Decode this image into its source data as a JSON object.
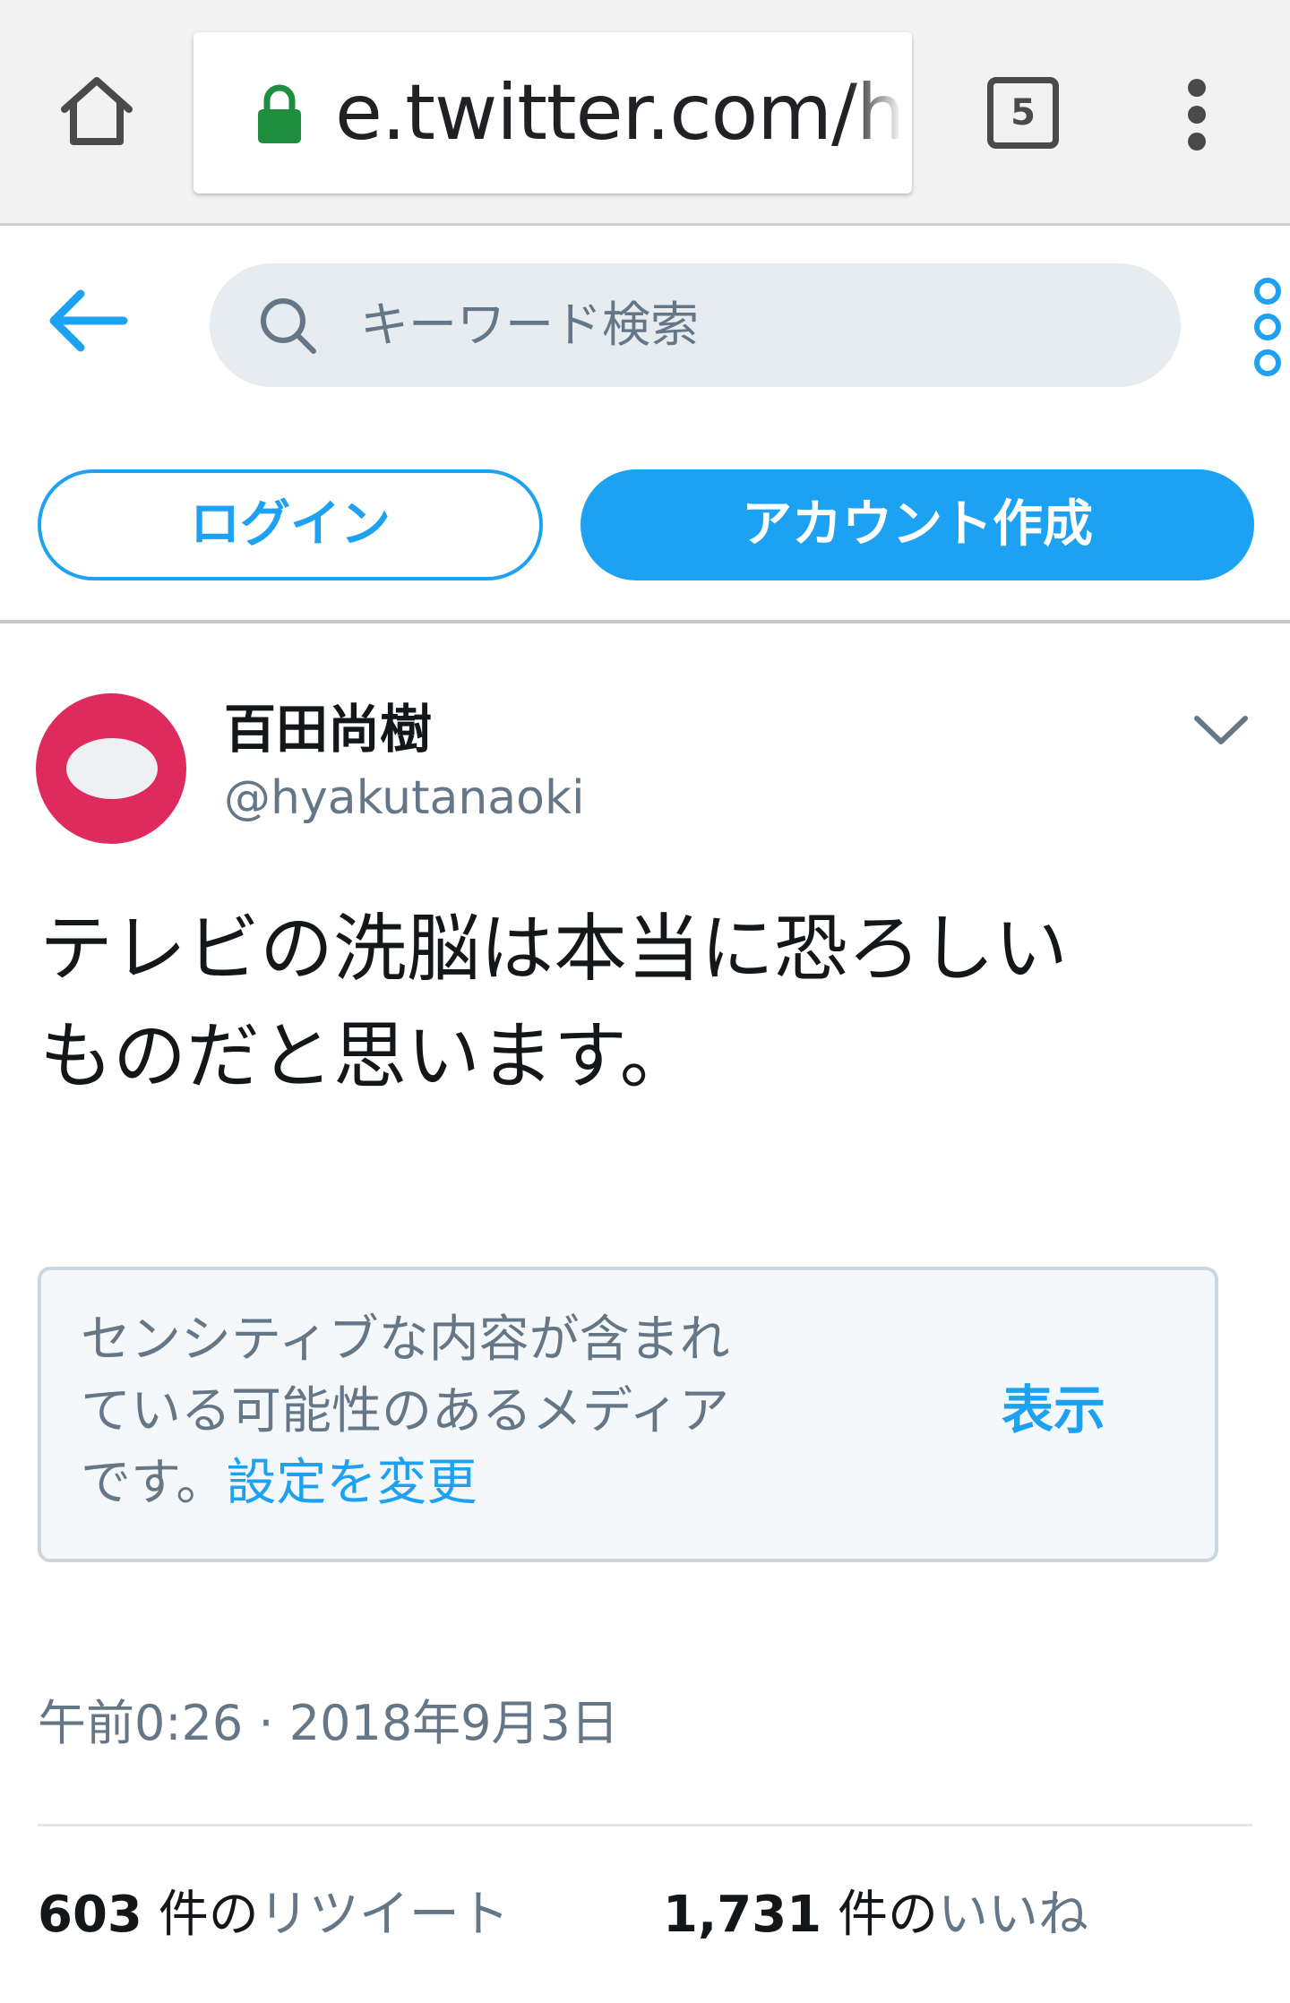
{
  "browser": {
    "url": "e.twitter.com/h",
    "tab_count": "5",
    "icons": {
      "home": "home-icon",
      "lock": "lock-icon",
      "menu": "more-vert-icon"
    },
    "colors": {
      "lock": "#1e8e3e"
    }
  },
  "header": {
    "search_placeholder": "キーワード検索",
    "login_label": "ログイン",
    "signup_label": "アカウント作成",
    "icons": {
      "back": "arrow-left-icon",
      "search": "search-icon",
      "more": "more-vertical-icon"
    }
  },
  "tweet": {
    "author_name": "百田尚樹",
    "author_handle": "@hyakutanaoki",
    "text_line1": "テレビの洗脳は本当に恐ろしい",
    "text_line2": "ものだと思います。",
    "media_warning": {
      "line1": "センシティブな内容が含まれ",
      "line2": "ている可能性のあるメディア",
      "line3_prefix": "です。",
      "settings_link": "設定を変更",
      "show_label": "表示"
    },
    "timestamp": "午前0:26 · 2018年9月3日",
    "stats": {
      "retweets_count": "603",
      "retweets_unit": "件の",
      "retweets_label": "リツイート",
      "likes_count": "1,731",
      "likes_unit": "件の",
      "likes_label": "いいね"
    }
  },
  "colors": {
    "brand": "#1da1f2",
    "secondary_text": "#657786",
    "avatar": "#de2a5c"
  }
}
